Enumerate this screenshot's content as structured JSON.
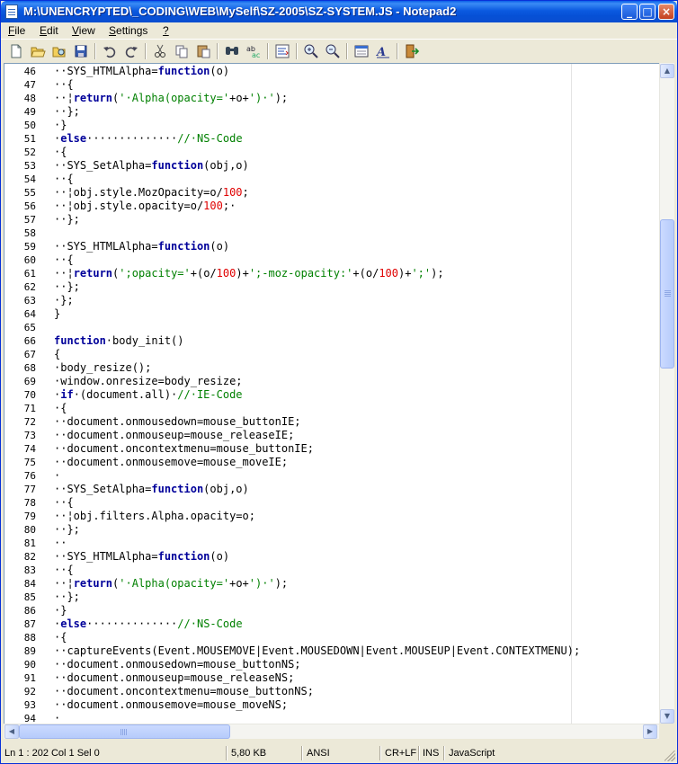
{
  "window": {
    "title": "M:\\UNENCRYPTED\\_CODING\\WEB\\MySelf\\SZ-2005\\SZ-SYSTEM.JS - Notepad2"
  },
  "menu": [
    {
      "accel": "F",
      "rest": "ile"
    },
    {
      "accel": "E",
      "rest": "dit"
    },
    {
      "accel": "V",
      "rest": "iew"
    },
    {
      "accel": "S",
      "rest": "ettings"
    },
    {
      "accel": "?",
      "rest": ""
    }
  ],
  "toolbar": [
    "new-file-icon",
    "open-folder-icon",
    "browse-icon",
    "save-icon",
    "undo-icon",
    "redo-icon",
    "cut-icon",
    "copy-icon",
    "paste-icon",
    "find-icon",
    "replace-icon",
    "word-wrap-icon",
    "zoom-in-icon",
    "zoom-out-icon",
    "settings-icon",
    "font-icon",
    "exit-icon"
  ],
  "lines": [
    {
      "n": "46",
      "segs": [
        [
          "t",
          "··SYS_HTMLAlpha="
        ],
        [
          "kw",
          "function"
        ],
        [
          "t",
          "(o)"
        ]
      ]
    },
    {
      "n": "47",
      "segs": [
        [
          "t",
          "··{"
        ]
      ]
    },
    {
      "n": "48",
      "segs": [
        [
          "t",
          "··¦"
        ],
        [
          "kw",
          "return"
        ],
        [
          "t",
          "("
        ],
        [
          "str",
          "'·Alpha(opacity='"
        ],
        [
          "t",
          "+o+"
        ],
        [
          "str",
          "')·'"
        ],
        [
          "t",
          ");"
        ]
      ]
    },
    {
      "n": "49",
      "segs": [
        [
          "t",
          "··};"
        ]
      ]
    },
    {
      "n": "50",
      "segs": [
        [
          "t",
          "·}"
        ]
      ]
    },
    {
      "n": "51",
      "segs": [
        [
          "t",
          "·"
        ],
        [
          "kw",
          "else"
        ],
        [
          "t",
          "··············"
        ],
        [
          "cmt",
          "//·NS-Code"
        ]
      ]
    },
    {
      "n": "52",
      "segs": [
        [
          "t",
          "·{"
        ]
      ]
    },
    {
      "n": "53",
      "segs": [
        [
          "t",
          "··SYS_SetAlpha="
        ],
        [
          "kw",
          "function"
        ],
        [
          "t",
          "(obj,o)"
        ]
      ]
    },
    {
      "n": "54",
      "segs": [
        [
          "t",
          "··{"
        ]
      ]
    },
    {
      "n": "55",
      "segs": [
        [
          "t",
          "··¦obj.style.MozOpacity=o/"
        ],
        [
          "num",
          "100"
        ],
        [
          "t",
          ";"
        ]
      ]
    },
    {
      "n": "56",
      "segs": [
        [
          "t",
          "··¦obj.style.opacity=o/"
        ],
        [
          "num",
          "100"
        ],
        [
          "t",
          ";·"
        ]
      ]
    },
    {
      "n": "57",
      "segs": [
        [
          "t",
          "··};"
        ]
      ]
    },
    {
      "n": "58",
      "segs": [
        [
          "t",
          ""
        ]
      ]
    },
    {
      "n": "59",
      "segs": [
        [
          "t",
          "··SYS_HTMLAlpha="
        ],
        [
          "kw",
          "function"
        ],
        [
          "t",
          "(o)"
        ]
      ]
    },
    {
      "n": "60",
      "segs": [
        [
          "t",
          "··{"
        ]
      ]
    },
    {
      "n": "61",
      "segs": [
        [
          "t",
          "··¦"
        ],
        [
          "kw",
          "return"
        ],
        [
          "t",
          "("
        ],
        [
          "str",
          "';opacity='"
        ],
        [
          "t",
          "+(o/"
        ],
        [
          "num",
          "100"
        ],
        [
          "t",
          ")+"
        ],
        [
          "str",
          "';-moz-opacity:'"
        ],
        [
          "t",
          "+(o/"
        ],
        [
          "num",
          "100"
        ],
        [
          "t",
          ")+"
        ],
        [
          "str",
          "';'"
        ],
        [
          "t",
          ");"
        ]
      ]
    },
    {
      "n": "62",
      "segs": [
        [
          "t",
          "··};"
        ]
      ]
    },
    {
      "n": "63",
      "segs": [
        [
          "t",
          "·};"
        ]
      ]
    },
    {
      "n": "64",
      "segs": [
        [
          "t",
          "}"
        ]
      ]
    },
    {
      "n": "65",
      "segs": [
        [
          "t",
          ""
        ]
      ]
    },
    {
      "n": "66",
      "segs": [
        [
          "kw",
          "function"
        ],
        [
          "t",
          "·body_init()"
        ]
      ]
    },
    {
      "n": "67",
      "segs": [
        [
          "t",
          "{"
        ]
      ]
    },
    {
      "n": "68",
      "segs": [
        [
          "t",
          "·body_resize();"
        ]
      ]
    },
    {
      "n": "69",
      "segs": [
        [
          "t",
          "·window.onresize=body_resize;"
        ]
      ]
    },
    {
      "n": "70",
      "segs": [
        [
          "t",
          "·"
        ],
        [
          "kw",
          "if"
        ],
        [
          "t",
          "·(document.all)·"
        ],
        [
          "cmt",
          "//·IE-Code"
        ]
      ]
    },
    {
      "n": "71",
      "segs": [
        [
          "t",
          "·{"
        ]
      ]
    },
    {
      "n": "72",
      "segs": [
        [
          "t",
          "··document.onmousedown=mouse_buttonIE;"
        ]
      ]
    },
    {
      "n": "73",
      "segs": [
        [
          "t",
          "··document.onmouseup=mouse_releaseIE;"
        ]
      ]
    },
    {
      "n": "74",
      "segs": [
        [
          "t",
          "··document.oncontextmenu=mouse_buttonIE;"
        ]
      ]
    },
    {
      "n": "75",
      "segs": [
        [
          "t",
          "··document.onmousemove=mouse_moveIE;"
        ]
      ]
    },
    {
      "n": "76",
      "segs": [
        [
          "t",
          "·"
        ]
      ]
    },
    {
      "n": "77",
      "segs": [
        [
          "t",
          "··SYS_SetAlpha="
        ],
        [
          "kw",
          "function"
        ],
        [
          "t",
          "(obj,o)"
        ]
      ]
    },
    {
      "n": "78",
      "segs": [
        [
          "t",
          "··{"
        ]
      ]
    },
    {
      "n": "79",
      "segs": [
        [
          "t",
          "··¦obj.filters.Alpha.opacity=o;"
        ]
      ]
    },
    {
      "n": "80",
      "segs": [
        [
          "t",
          "··};"
        ]
      ]
    },
    {
      "n": "81",
      "segs": [
        [
          "t",
          "··"
        ]
      ]
    },
    {
      "n": "82",
      "segs": [
        [
          "t",
          "··SYS_HTMLAlpha="
        ],
        [
          "kw",
          "function"
        ],
        [
          "t",
          "(o)"
        ]
      ]
    },
    {
      "n": "83",
      "segs": [
        [
          "t",
          "··{"
        ]
      ]
    },
    {
      "n": "84",
      "segs": [
        [
          "t",
          "··¦"
        ],
        [
          "kw",
          "return"
        ],
        [
          "t",
          "("
        ],
        [
          "str",
          "'·Alpha(opacity='"
        ],
        [
          "t",
          "+o+"
        ],
        [
          "str",
          "')·'"
        ],
        [
          "t",
          ");"
        ]
      ]
    },
    {
      "n": "85",
      "segs": [
        [
          "t",
          "··};"
        ]
      ]
    },
    {
      "n": "86",
      "segs": [
        [
          "t",
          "·}"
        ]
      ]
    },
    {
      "n": "87",
      "segs": [
        [
          "t",
          "·"
        ],
        [
          "kw",
          "else"
        ],
        [
          "t",
          "··············"
        ],
        [
          "cmt",
          "//·NS-Code"
        ]
      ]
    },
    {
      "n": "88",
      "segs": [
        [
          "t",
          "·{"
        ]
      ]
    },
    {
      "n": "89",
      "segs": [
        [
          "t",
          "··captureEvents(Event.MOUSEMOVE|Event.MOUSEDOWN|Event.MOUSEUP|Event.CONTEXTMENU);"
        ]
      ]
    },
    {
      "n": "90",
      "segs": [
        [
          "t",
          "··document.onmousedown=mouse_buttonNS;"
        ]
      ]
    },
    {
      "n": "91",
      "segs": [
        [
          "t",
          "··document.onmouseup=mouse_releaseNS;"
        ]
      ]
    },
    {
      "n": "92",
      "segs": [
        [
          "t",
          "··document.oncontextmenu=mouse_buttonNS;"
        ]
      ]
    },
    {
      "n": "93",
      "segs": [
        [
          "t",
          "··document.onmousemove=mouse_moveNS;"
        ]
      ]
    },
    {
      "n": "94",
      "segs": [
        [
          "t",
          "·"
        ]
      ]
    }
  ],
  "statusbar": {
    "position": "Ln 1 : 202   Col 1   Sel 0",
    "size": "5,80 KB",
    "encoding": "ANSI",
    "line_ending": "CR+LF",
    "mode": "INS",
    "lexer": "JavaScript"
  }
}
